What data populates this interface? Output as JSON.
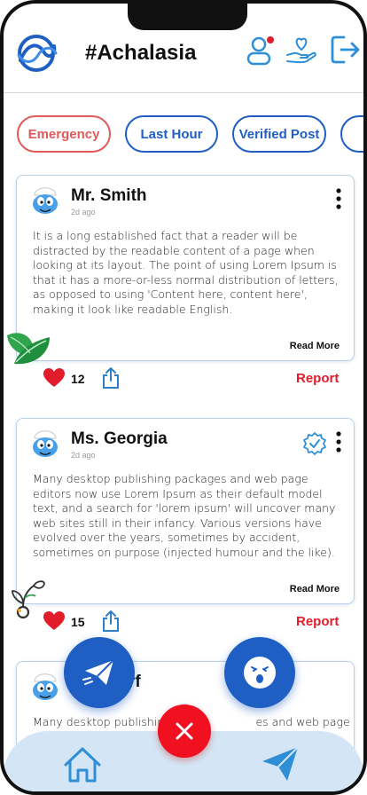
{
  "header": {
    "title": "#Achalasia",
    "icons": [
      "logo-icon",
      "user-icon",
      "care-icon",
      "logout-icon"
    ]
  },
  "filters": [
    {
      "label": "Emergency"
    },
    {
      "label": "Last Hour"
    },
    {
      "label": "Verified Post"
    },
    {
      "label": ""
    }
  ],
  "posts": [
    {
      "author": "Mr. Smith",
      "ago": "2d ago",
      "body": "It is a long established fact that a reader will be distracted by the readable content of a page when looking at its layout. The point of using Lorem Ipsum is that it has a more-or-less normal distribution of letters, as opposed to using 'Content here, content here', making it look like readable English.",
      "read_more": "Read More",
      "likes": "12",
      "report": "Report",
      "verified": false
    },
    {
      "author": "Ms. Georgia",
      "ago": "2d ago",
      "body": "Many desktop publishing packages and web page editors now use Lorem Ipsum as their default model text, and a search for 'lorem ipsum' will uncover many web sites still in their infancy. Various versions have evolved over the years, sometimes by accident, sometimes on purpose (injected humour and the like).",
      "read_more": "Read More",
      "likes": "15",
      "report": "Report",
      "verified": true
    },
    {
      "author": "rf",
      "ago": "",
      "body": "Many desktop publishin                          es and web page"
    }
  ],
  "colors": {
    "primary": "#1f5fc4",
    "danger": "#e21d2b",
    "emergency": "#e05a5a",
    "bottom_bar": "#d4e6f5"
  }
}
